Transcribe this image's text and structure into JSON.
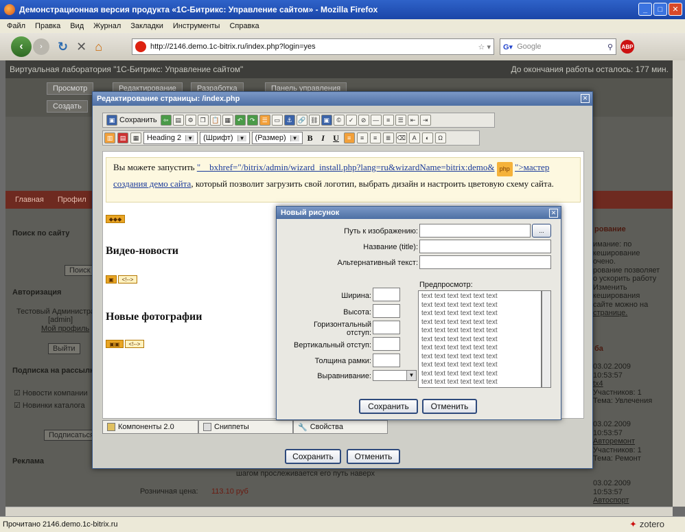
{
  "browser": {
    "window_title": "Демонстрационная версия продукта «1С-Битрикс: Управление сайтом» - Mozilla Firefox",
    "menu": [
      "Файл",
      "Правка",
      "Вид",
      "Журнал",
      "Закладки",
      "Инструменты",
      "Справка"
    ],
    "url": "http://2146.demo.1c-bitrix.ru/index.php?login=yes",
    "search_placeholder": "Google",
    "abp_label": "ABP",
    "status_text": "Прочитано 2146.demo.1c-bitrix.ru",
    "zotero_label": "zotero"
  },
  "background_page": {
    "lab_title": "Виртуальная лаборатория \"1С-Битрикс: Управление сайтом\"",
    "timer_text": "До окончания работы осталось: 177 мин.",
    "admin_tabs": [
      "Просмотр",
      "Редактирование",
      "Разработка",
      "Панель управления"
    ],
    "create_label": "Создать",
    "red_menu": [
      "Главная",
      "Профил"
    ],
    "search_title": "Поиск по сайту",
    "search_button": "Поиск",
    "auth_title": "Авторизация",
    "user_line1": "Тестовый Администратор",
    "user_line2": "[admin]",
    "my_profile": "Мой профиль",
    "logout_button": "Выйти",
    "subscribe_title": "Подписка на рассылку",
    "sub_items": [
      "Новости компании",
      "Новинки каталога"
    ],
    "subscribe_button": "Подписаться",
    "ads_title": "Реклама",
    "price_label": "Розничная цена:",
    "price_value": "113.10 руб",
    "right_col": {
      "title": "рование",
      "lines": [
        "имание: по",
        "кеширование",
        "очено.",
        "рование позволяет",
        "о ускорить работу",
        "Изменить",
        "кеширования",
        "сайте можно на",
        "странице."
      ],
      "forum_title": "ба",
      "entries": [
        {
          "date": "03.02.2009",
          "time": "10:53:57",
          "name": "tx4",
          "members": "Участников: 1",
          "topic": "Тема: Увлечения"
        },
        {
          "date": "03.02.2009",
          "time": "10:53:57",
          "name": "Авторемонт",
          "members": "Участников: 1",
          "topic": "Тема: Ремонт"
        },
        {
          "date": "03.02.2009",
          "time": "10:53:57",
          "name": "Автоспорт",
          "members": "",
          "topic": ""
        }
      ]
    },
    "footer_text": "шагом прослеживается его путь наверх"
  },
  "editor": {
    "title": "Редактирование страницы: /index.php",
    "save_toolbar_label": "Сохранить",
    "format_select": "Heading 2",
    "font_select": "(Шрифт)",
    "size_select": "(Размер)",
    "notice": {
      "text_before": "Вы можете запустить ",
      "link_part1": "\"__bxhref=\"/bitrix/admin/wizard_install.php?lang=ru&wizardName=bitrix:demo&",
      "php_badge": "php",
      "link_part2": "\">мастер создания демо сайта",
      "text_after": ", который позволит загрузить свой логотип, выбрать дизайн и настроить цветовую схему сайта."
    },
    "heading_video": "Видео-новости",
    "heading_photos": "Новые фотографии",
    "comment_marker": "<!-->",
    "tabs": [
      "Компоненты 2.0",
      "Сниппеты",
      "Свойства"
    ],
    "save_button": "Сохранить",
    "cancel_button": "Отменить"
  },
  "image_dialog": {
    "title": "Новый рисунок",
    "path_label": "Путь к изображению:",
    "browse_label": "...",
    "title_label": "Название (title):",
    "alt_label": "Альтернативный текст:",
    "preview_label": "Предпросмотр:",
    "width_label": "Ширина:",
    "height_label": "Высота:",
    "hspace_label": "Горизонтальный отступ:",
    "vspace_label": "Вертикальный отступ:",
    "border_label": "Толщина рамки:",
    "align_label": "Выравнивание:",
    "preview_line": "text text text text text text",
    "save_button": "Сохранить",
    "cancel_button": "Отменить"
  }
}
